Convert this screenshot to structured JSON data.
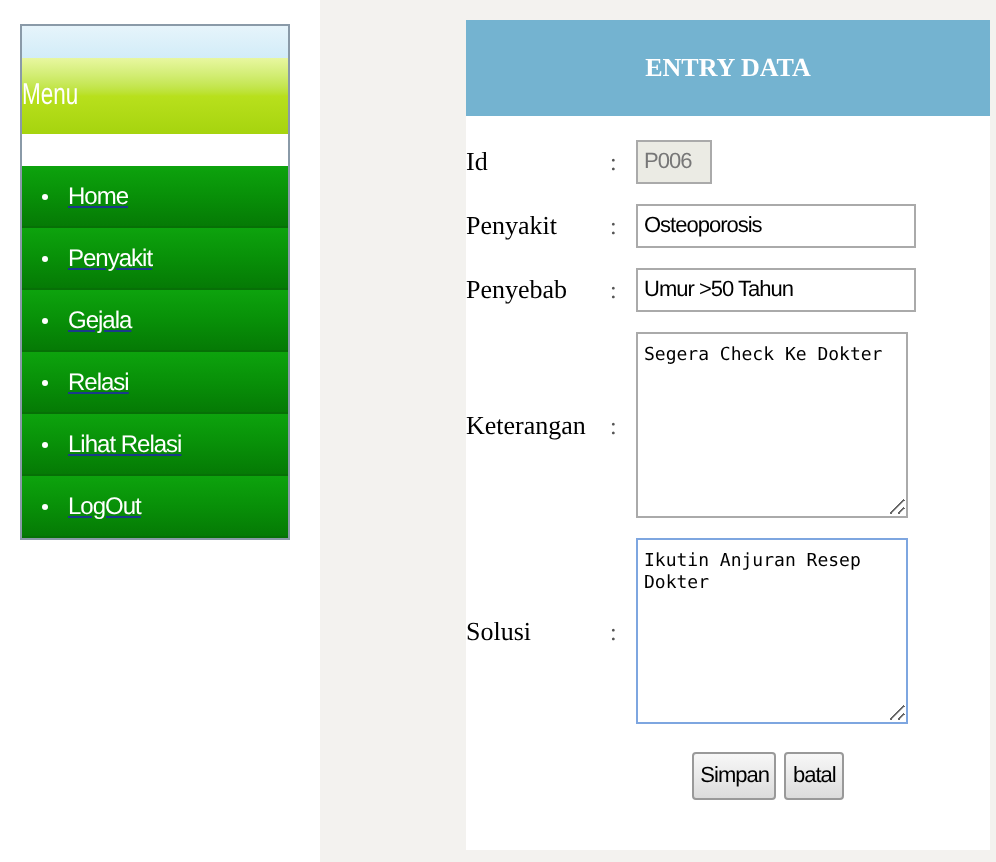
{
  "sidebar": {
    "title": "Menu",
    "items": [
      {
        "label": "Home"
      },
      {
        "label": "Penyakit"
      },
      {
        "label": "Gejala"
      },
      {
        "label": "Relasi"
      },
      {
        "label": "Lihat Relasi"
      },
      {
        "label": "LogOut"
      }
    ]
  },
  "form": {
    "title": "ENTRY DATA",
    "fields": [
      {
        "label": "Id",
        "separator": ":",
        "kind": "text",
        "value": "P006",
        "disabled": true,
        "focused": false
      },
      {
        "label": "Penyakit",
        "separator": ":",
        "kind": "text",
        "value": "Osteoporosis",
        "disabled": false,
        "focused": false
      },
      {
        "label": "Penyebab",
        "separator": ":",
        "kind": "text",
        "value": "Umur >50 Tahun",
        "disabled": false,
        "focused": false
      },
      {
        "label": "Keterangan",
        "separator": ":",
        "kind": "textarea",
        "value": "Segera Check Ke Dokter",
        "disabled": false,
        "focused": false
      },
      {
        "label": "Solusi",
        "separator": ":",
        "kind": "textarea",
        "value": "Ikutin Anjuran Resep Dokter",
        "disabled": false,
        "focused": true
      }
    ],
    "buttons": [
      "Simpan",
      "batal"
    ]
  }
}
